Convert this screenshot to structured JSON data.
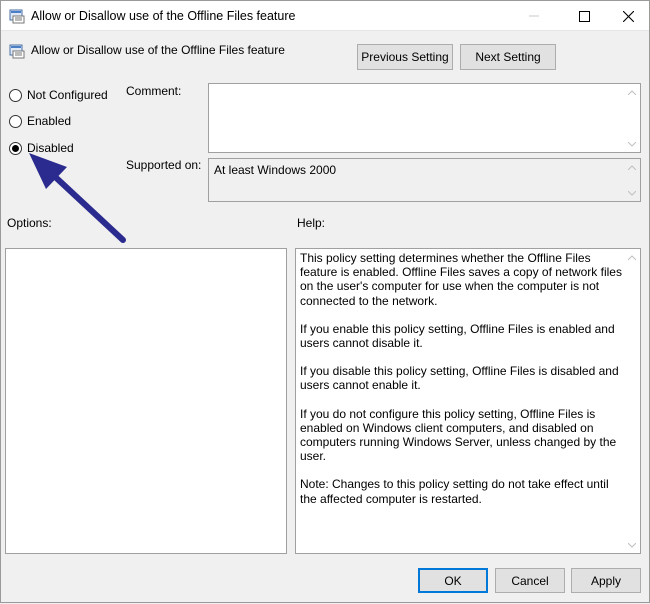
{
  "window": {
    "title": "Allow or Disallow use of the Offline Files feature",
    "controls": {
      "minimize_icon": "minimize-icon",
      "maximize_icon": "maximize-icon",
      "close_icon": "close-icon"
    }
  },
  "header": {
    "policy_title": "Allow or Disallow use of the Offline Files feature",
    "prev_label": "Previous Setting",
    "next_label": "Next Setting"
  },
  "state": {
    "options": [
      {
        "label": "Not Configured",
        "selected": false
      },
      {
        "label": "Enabled",
        "selected": false
      },
      {
        "label": "Disabled",
        "selected": true
      }
    ]
  },
  "comment": {
    "label": "Comment:",
    "value": ""
  },
  "supported": {
    "label": "Supported on:",
    "value": "At least Windows 2000"
  },
  "options_panel": {
    "label": "Options:"
  },
  "help": {
    "label": "Help:",
    "paragraphs": [
      "This policy setting determines whether the Offline Files feature is enabled. Offline Files saves a copy of network files on the user's computer for use when the computer is not connected to the network.",
      "If you enable this policy setting, Offline Files is enabled and users cannot disable it.",
      "If you disable this policy setting, Offline Files is disabled and users cannot enable it.",
      "If you do not configure this policy setting, Offline Files is enabled on Windows client computers, and disabled on computers running Windows Server, unless changed by the user.",
      "Note: Changes to this policy setting do not take effect until the affected computer is restarted."
    ]
  },
  "footer": {
    "ok_label": "OK",
    "cancel_label": "Cancel",
    "apply_label": "Apply"
  },
  "colors": {
    "annotation_arrow": "#2b2b8f",
    "default_button_border": "#0078d7"
  }
}
